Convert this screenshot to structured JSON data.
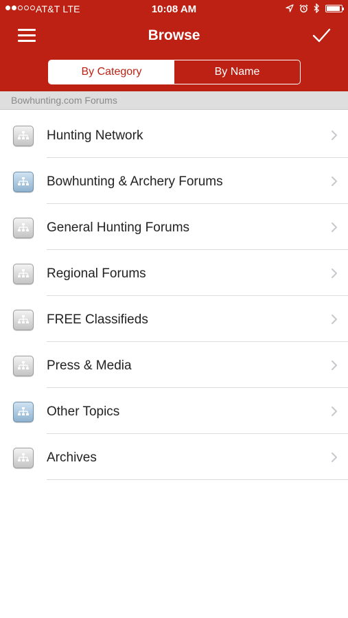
{
  "status_bar": {
    "carrier": "AT&T  LTE",
    "time": "10:08 AM",
    "signal_bars_filled": 2,
    "signal_bars_total": 5
  },
  "nav": {
    "title": "Browse"
  },
  "segmented_control": {
    "options": [
      {
        "label": "By Category",
        "selected": true
      },
      {
        "label": "By Name",
        "selected": false
      }
    ]
  },
  "section": {
    "header": "Bowhunting.com Forums"
  },
  "forums": [
    {
      "label": "Hunting Network",
      "icon": "forum-tree-icon",
      "icon_color": "gray"
    },
    {
      "label": "Bowhunting & Archery Forums",
      "icon": "forum-tree-icon",
      "icon_color": "blue"
    },
    {
      "label": "General Hunting Forums",
      "icon": "forum-tree-icon",
      "icon_color": "gray"
    },
    {
      "label": "Regional Forums",
      "icon": "forum-tree-icon",
      "icon_color": "gray"
    },
    {
      "label": "FREE Classifieds",
      "icon": "forum-tree-icon",
      "icon_color": "gray"
    },
    {
      "label": "Press & Media",
      "icon": "forum-tree-icon",
      "icon_color": "gray"
    },
    {
      "label": "Other Topics",
      "icon": "forum-tree-icon",
      "icon_color": "blue"
    },
    {
      "label": "Archives",
      "icon": "forum-tree-icon",
      "icon_color": "gray"
    }
  ],
  "colors": {
    "brand_red": "#bd2113",
    "section_bg": "#dedede",
    "text": "#222222",
    "chevron": "#c7c7cc"
  }
}
